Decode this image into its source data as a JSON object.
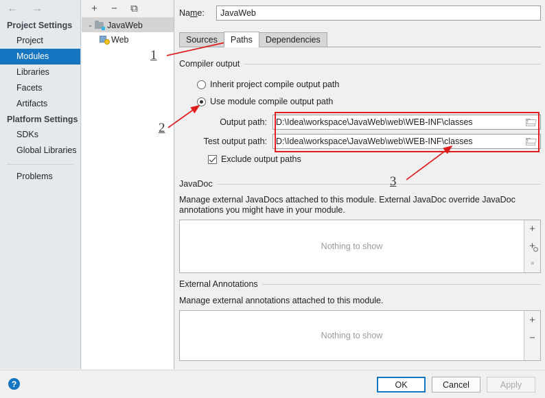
{
  "sidebar": {
    "back_arrow": "←",
    "forward_arrow": "→",
    "groups": [
      {
        "title": "Project Settings",
        "items": [
          {
            "label": "Project",
            "selected": false
          },
          {
            "label": "Modules",
            "selected": true
          },
          {
            "label": "Libraries",
            "selected": false
          },
          {
            "label": "Facets",
            "selected": false
          },
          {
            "label": "Artifacts",
            "selected": false
          }
        ]
      },
      {
        "title": "Platform Settings",
        "items": [
          {
            "label": "SDKs",
            "selected": false
          },
          {
            "label": "Global Libraries",
            "selected": false
          }
        ]
      }
    ],
    "problems_label": "Problems"
  },
  "tree": {
    "toolbar": {
      "add": "+",
      "remove": "−",
      "copy": "⧉"
    },
    "nodes": [
      {
        "label": "JavaWeb",
        "chevron": "⌄",
        "selected": true
      },
      {
        "label": "Web",
        "selected": false
      }
    ]
  },
  "main": {
    "name_label_pre": "Na",
    "name_label_mnemonic": "m",
    "name_label_post": "e:",
    "name_value": "JavaWeb",
    "tabs": [
      {
        "label": "Sources",
        "active": false
      },
      {
        "label": "Paths",
        "active": true
      },
      {
        "label": "Dependencies",
        "active": false
      }
    ],
    "compiler_output": {
      "title": "Compiler output",
      "radio_inherit": "Inherit project compile output path",
      "radio_module": "Use module compile output path",
      "selected_radio": "module",
      "output_path_label": "Output path:",
      "output_path_value": "D:\\Idea\\workspace\\JavaWeb\\web\\WEB-INF\\classes",
      "test_output_path_label": "Test output path:",
      "test_output_path_value": "D:\\Idea\\workspace\\JavaWeb\\web\\WEB-INF\\classes",
      "exclude_label": "Exclude output paths",
      "exclude_checked": true
    },
    "javadoc": {
      "title": "JavaDoc",
      "description": "Manage external JavaDocs attached to this module. External JavaDoc override JavaDoc annotations you might have in your module.",
      "empty_text": "Nothing to show",
      "buttons": {
        "add": "+",
        "add_url": "+",
        "expand": "»"
      }
    },
    "external_annotations": {
      "title": "External Annotations",
      "description": "Manage external annotations attached to this module.",
      "empty_text": "Nothing to show",
      "buttons": {
        "add": "+",
        "remove": "−"
      }
    }
  },
  "footer": {
    "help": "?",
    "ok": "OK",
    "cancel": "Cancel",
    "apply": "Apply"
  },
  "annotations": {
    "marker_1": "1",
    "marker_2": "2",
    "marker_3": "3",
    "highlight_color": "#e01b1b"
  }
}
